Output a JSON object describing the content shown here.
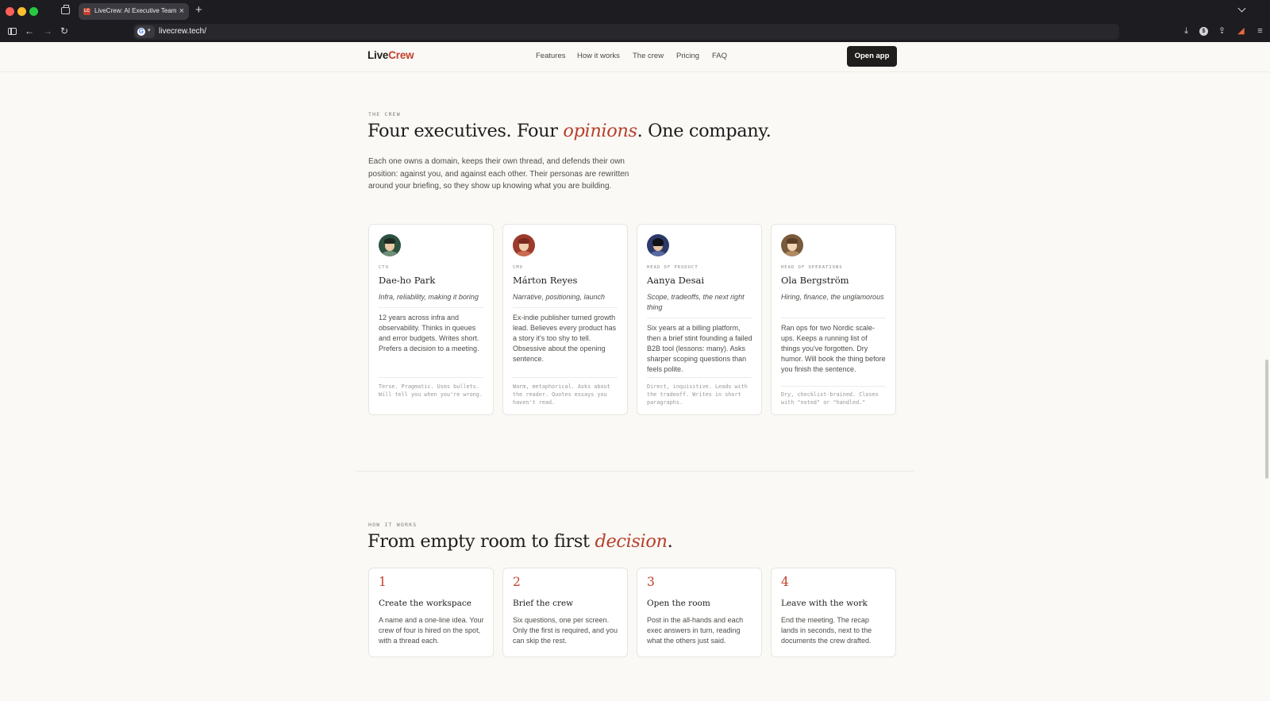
{
  "browser": {
    "tab_title": "LiveCrew: AI Executive Team",
    "tab_favicon": "LC",
    "url": "livecrew.tech/",
    "icons": [
      "tab-overview-icon",
      "sidebar-icon",
      "back-icon",
      "forward-icon",
      "reload-icon",
      "download-icon",
      "extension-icon",
      "share-icon",
      "extension-icon",
      "menu-icon"
    ]
  },
  "site": {
    "logo_part1": "Live",
    "logo_part2": "Crew",
    "nav": [
      "Features",
      "How it works",
      "The crew",
      "Pricing",
      "FAQ"
    ],
    "cta": "Open app",
    "accent_color": "#c2412d"
  },
  "crew_section": {
    "eyebrow": "THE CREW",
    "headline_before": "Four executives. Four ",
    "headline_em": "opinions",
    "headline_after": ". One company.",
    "intro": "Each one owns a domain, keeps their own thread, and defends their own position: against you, and against each other. Their personas are rewritten around your briefing, so they show up knowing what you are building.",
    "cards": [
      {
        "role": "CTO",
        "name": "Dae-ho Park",
        "domain": "Infra, reliability, making it boring",
        "bio": "12 years across infra and observability. Thinks in queues and error budgets. Writes short. Prefers a decision to a meeting.",
        "voice": "Terse. Pragmatic. Uses bullets. Will tell you when you're wrong."
      },
      {
        "role": "CMO",
        "name": "Márton Reyes",
        "domain": "Narrative, positioning, launch",
        "bio": "Ex-indie publisher turned growth lead. Believes every product has a story it's too shy to tell. Obsessive about the opening sentence.",
        "voice": "Warm, metaphorical. Asks about the reader. Quotes essays you haven't read."
      },
      {
        "role": "HEAD OF PRODUCT",
        "name": "Aanya Desai",
        "domain": "Scope, tradeoffs, the next right thing",
        "bio": "Six years at a billing platform, then a brief stint founding a failed B2B tool (lessons: many). Asks sharper scoping questions than feels polite.",
        "voice": "Direct, inquisitive. Leads with the tradeoff. Writes in short paragraphs."
      },
      {
        "role": "HEAD OF OPERATIONS",
        "name": "Ola Bergström",
        "domain": "Hiring, finance, the unglamorous",
        "bio": "Ran ops for two Nordic scale-ups. Keeps a running list of things you've forgotten. Dry humor. Will book the thing before you finish the sentence.",
        "voice": "Dry, checklist-brained. Closes with \"noted\" or \"handled.\""
      }
    ]
  },
  "how_section": {
    "eyebrow": "HOW IT WORKS",
    "headline_before": "From empty room to first ",
    "headline_em": "decision",
    "headline_after": ".",
    "steps": [
      {
        "num": "1",
        "title": "Create the workspace",
        "desc": "A name and a one-line idea. Your crew of four is hired on the spot, with a thread each."
      },
      {
        "num": "2",
        "title": "Brief the crew",
        "desc": "Six questions, one per screen. Only the first is required, and you can skip the rest."
      },
      {
        "num": "3",
        "title": "Open the room",
        "desc": "Post in the all-hands and each exec answers in turn, reading what the others just said."
      },
      {
        "num": "4",
        "title": "Leave with the work",
        "desc": "End the meeting. The recap lands in seconds, next to the documents the crew drafted."
      }
    ]
  }
}
